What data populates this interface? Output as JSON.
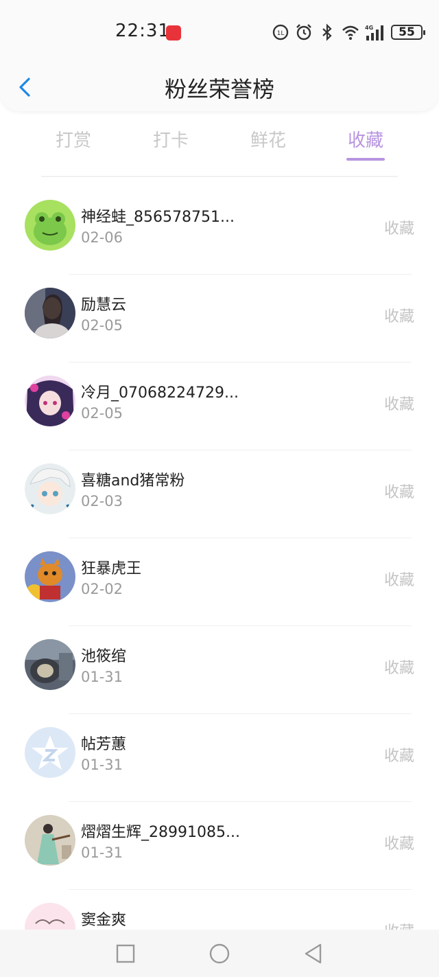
{
  "status_bar": {
    "time": "22:31",
    "battery": "55",
    "icons": [
      "app-badge-icon",
      "data-saver-icon",
      "alarm-icon",
      "bluetooth-icon",
      "wifi-icon",
      "4g-signal-icon",
      "battery-icon"
    ]
  },
  "header": {
    "title": "粉丝荣誉榜",
    "back_icon": "chevron-left-icon"
  },
  "tabs": [
    {
      "label": "打赏",
      "active": false
    },
    {
      "label": "打卡",
      "active": false
    },
    {
      "label": "鲜花",
      "active": false
    },
    {
      "label": "收藏",
      "active": true
    }
  ],
  "fans": [
    {
      "name": "神经蛙_856578751...",
      "date": "02-06",
      "action": "收藏",
      "avatar": "frog-avatar"
    },
    {
      "name": "励慧云",
      "date": "02-05",
      "action": "收藏",
      "avatar": "girl-photo-avatar"
    },
    {
      "name": "冷月_07068224729...",
      "date": "02-05",
      "action": "收藏",
      "avatar": "anime-girl-avatar"
    },
    {
      "name": "喜糖and猪常粉",
      "date": "02-03",
      "action": "收藏",
      "avatar": "anime-boy-avatar"
    },
    {
      "name": "狂暴虎王",
      "date": "02-02",
      "action": "收藏",
      "avatar": "tiger-game-avatar"
    },
    {
      "name": "池筱绾",
      "date": "01-31",
      "action": "收藏",
      "avatar": "dark-photo-avatar"
    },
    {
      "name": "帖芳蕙",
      "date": "01-31",
      "action": "收藏",
      "avatar": "default-star-avatar"
    },
    {
      "name": "熠熠生辉_28991085...",
      "date": "01-31",
      "action": "收藏",
      "avatar": "painting-avatar"
    },
    {
      "name": "窦金爽",
      "date": "",
      "action": "收藏",
      "avatar": "pink-sketch-avatar"
    }
  ],
  "colors": {
    "accent": "#b794e0",
    "tab_inactive": "#c8c8c8",
    "date_text": "#9a9a9a",
    "action_text": "#c4c4c4",
    "back_icon": "#1e88e5"
  },
  "system_nav": [
    "recents-square-icon",
    "home-circle-icon",
    "back-triangle-icon"
  ]
}
